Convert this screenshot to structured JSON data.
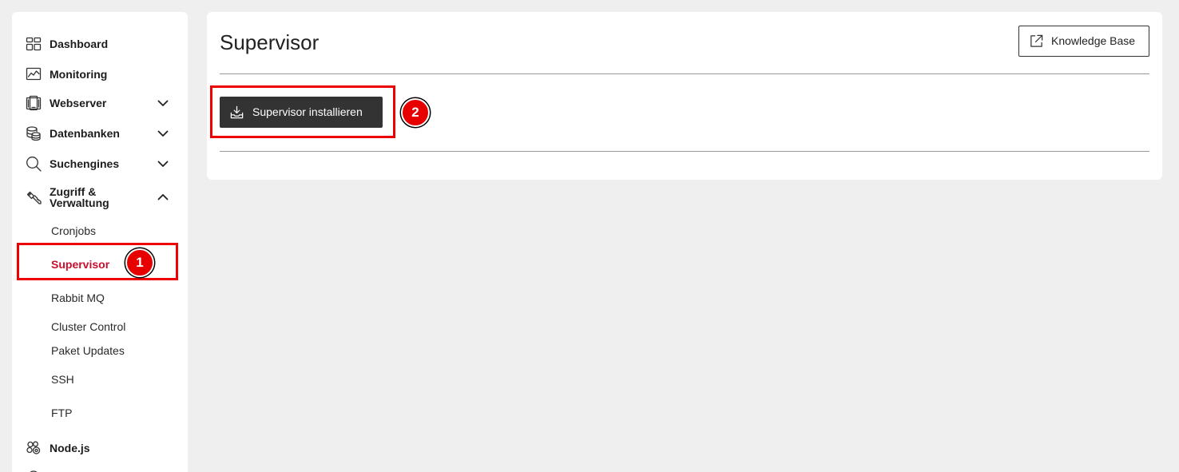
{
  "sidebar": {
    "items": [
      {
        "label": "Dashboard",
        "icon": "dashboard-icon"
      },
      {
        "label": "Monitoring",
        "icon": "monitoring-icon"
      },
      {
        "label": "Webserver",
        "icon": "webserver-icon",
        "toggle_icon": "chevron-down-icon"
      },
      {
        "label": "Datenbanken",
        "icon": "database-icon",
        "toggle_icon": "chevron-down-icon"
      },
      {
        "label": "Suchengines",
        "icon": "search-icon",
        "toggle_icon": "chevron-down-icon"
      },
      {
        "label": "Zugriff & Verwaltung",
        "icon": "key-icon",
        "toggle_icon": "chevron-up-icon",
        "children": [
          {
            "label": "Cronjobs"
          },
          {
            "label": "Supervisor",
            "active": true
          },
          {
            "label": "Rabbit MQ"
          },
          {
            "label": "Cluster Control"
          },
          {
            "label": "Paket Updates"
          },
          {
            "label": "SSH"
          },
          {
            "label": "FTP"
          }
        ]
      },
      {
        "label": "Node.js",
        "icon": "nodejs-icon"
      }
    ]
  },
  "main": {
    "title": "Supervisor",
    "knowledge_base": {
      "label": "Knowledge Base",
      "icon": "external-link-icon"
    },
    "install_button": {
      "label": "Supervisor installieren",
      "icon": "download-icon"
    }
  },
  "annotations": [
    {
      "number": "1"
    },
    {
      "number": "2"
    }
  ],
  "colors": {
    "background": "#efefef",
    "card": "#ffffff",
    "active_item": "#c8102e",
    "primary_button": "#333333",
    "annotation": "#ee0000"
  }
}
